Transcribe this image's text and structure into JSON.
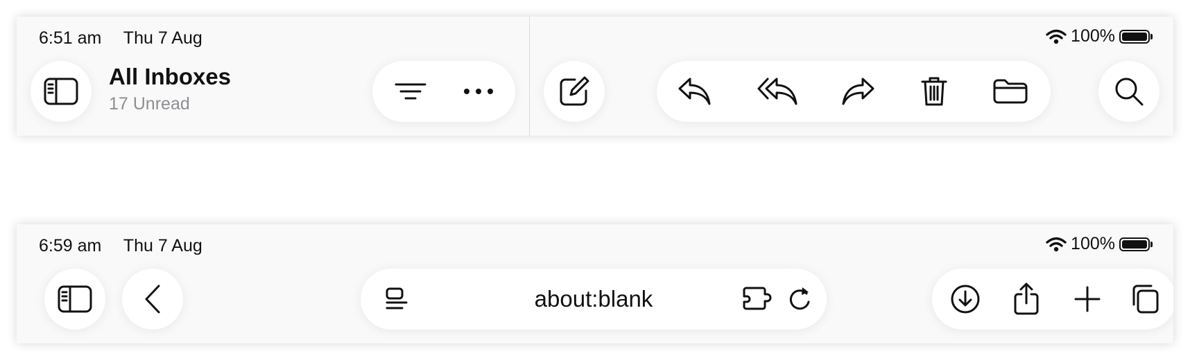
{
  "mail": {
    "status": {
      "time": "6:51 am",
      "date": "Thu 7 Aug",
      "battery": "100%"
    },
    "header": {
      "title": "All Inboxes",
      "subtitle": "17 Unread"
    },
    "icons": [
      "sidebar-icon",
      "filter-icon",
      "more-icon",
      "compose-icon",
      "reply-icon",
      "reply-all-icon",
      "forward-icon",
      "trash-icon",
      "folder-icon",
      "search-icon"
    ]
  },
  "safari": {
    "status": {
      "time": "6:59 am",
      "date": "Thu 7 Aug",
      "battery": "100%"
    },
    "address": {
      "url": "about:blank"
    },
    "icons": [
      "sidebar-icon",
      "back-icon",
      "page-menu-icon",
      "extension-icon",
      "reload-icon",
      "download-icon",
      "share-icon",
      "plus-icon",
      "tabs-icon"
    ]
  },
  "colors": {
    "background": "#f9f9f9",
    "button": "#ffffff",
    "text": "#111111",
    "secondary_text": "#8e8e93"
  }
}
